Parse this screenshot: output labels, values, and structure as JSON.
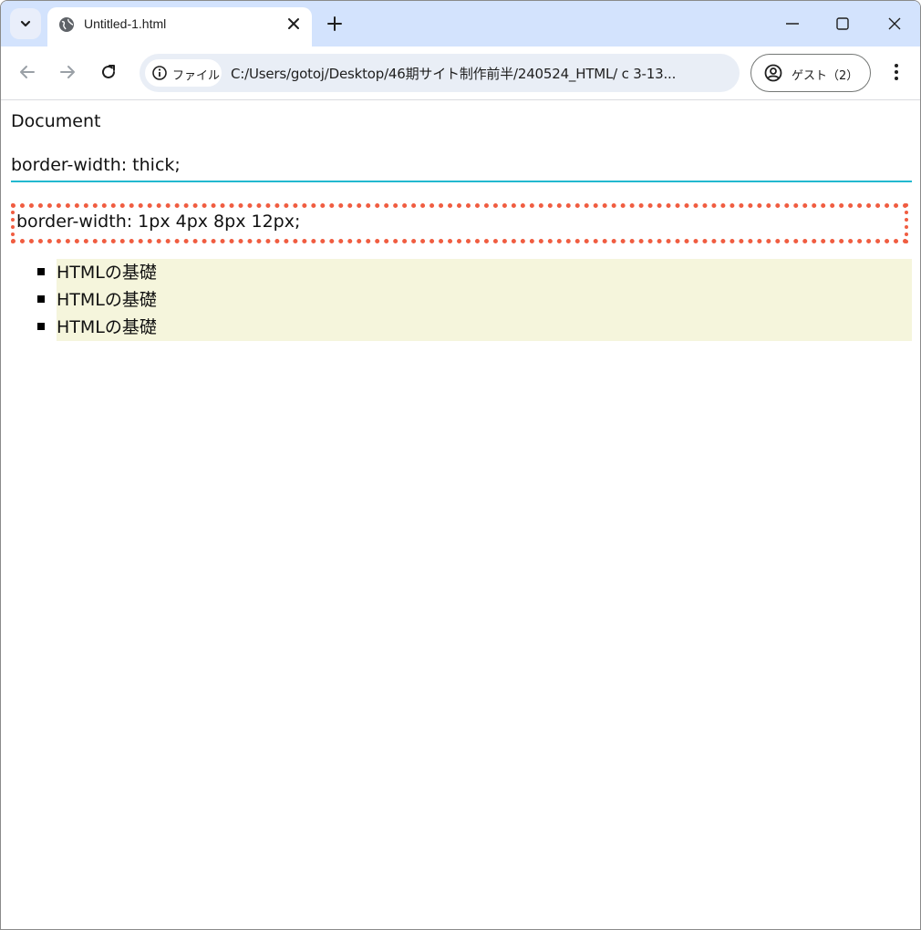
{
  "browser": {
    "tab": {
      "title": "Untitled-1.html"
    },
    "omnibox": {
      "chip_label": "ファイル",
      "url": "C:/Users/gotoj/Desktop/46期サイト制作前半/240524_HTML/ c 3-13..."
    },
    "profile": {
      "label": "ゲスト（2）"
    }
  },
  "page": {
    "title": "Document",
    "heading_thick": "border-width: thick;",
    "box_dotted": "border-width: 1px 4px 8px 12px;",
    "list_items": [
      "HTMLの基礎",
      "HTMLの基礎",
      "HTMLの基礎"
    ]
  },
  "colors": {
    "tabstrip_bg": "#d3e3fd",
    "thick_border": "#22b8cf",
    "dotted_border": "#f05d41",
    "list_bg": "#f5f5dc"
  }
}
